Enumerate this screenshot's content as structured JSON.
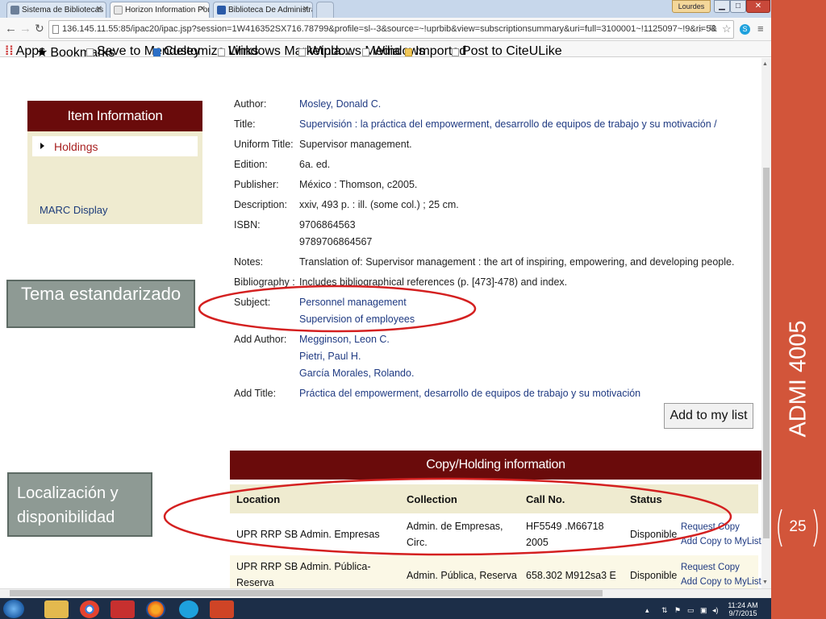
{
  "browser": {
    "tabs": [
      {
        "label": "Sistema de Bibliotecas",
        "active": false
      },
      {
        "label": "Horizon Information Porta",
        "active": true
      },
      {
        "label": "Biblioteca De Administrac",
        "active": false
      }
    ],
    "profile_label": "Lourdes",
    "url": "136.145.11.55:85/ipac20/ipac.jsp?session=1W416352SX716.78799&profile=sl--3&source=~!uprbib&view=subscriptionsummary&uri=full=3100001~!1125097~!9&ri=5&",
    "bookmarks": [
      "Apps",
      "Bookmarks",
      "Save to Mendeley",
      "Customize Links",
      "Windows Marketpla...",
      "Windows Media",
      "Windows",
      "Imported",
      "Post to CiteULike"
    ]
  },
  "sidebar_menu": {
    "header": "Item Information",
    "holdings": "Holdings",
    "marc": "MARC Display"
  },
  "record": {
    "author_label": "Author:",
    "author": "Mosley, Donald C.",
    "title_label": "Title:",
    "title": "Supervisión : la práctica del empowerment, desarrollo de equipos de trabajo y su motivación /",
    "uniform_label": "Uniform Title:",
    "uniform": "Supervisor management.",
    "edition_label": "Edition:",
    "edition": "6a. ed.",
    "publisher_label": "Publisher:",
    "publisher": "México : Thomson, c2005.",
    "description_label": "Description:",
    "description": "xxiv, 493 p. : ill. (some col.) ; 25 cm.",
    "isbn_label": "ISBN:",
    "isbn1": "9706864563",
    "isbn2": "9789706864567",
    "notes_label": "Notes:",
    "notes": "Translation of: Supervisor management : the art of inspiring, empowering, and developing people.",
    "bibliography_label": "Bibliography :",
    "bibliography": "Includes bibliographical references (p. [473]-478) and index.",
    "subject_label": "Subject:",
    "subject1": "Personnel management",
    "subject2": "Supervision of employees",
    "add_author_label": "Add Author:",
    "add_author1": "Megginson, Leon C.",
    "add_author2": "Pietri, Paul H.",
    "add_author3": "García Morales, Rolando.",
    "add_title_label": "Add Title:",
    "add_title": "Práctica del empowerment, desarrollo de equipos de trabajo y su motivación"
  },
  "add_to_list": "Add to my list",
  "copy_holding": {
    "header": "Copy/Holding information",
    "columns": [
      "Location",
      "Collection",
      "Call No.",
      "Status"
    ],
    "rows": [
      {
        "location": "UPR RRP SB Admin. Empresas",
        "collection": "Admin. de Empresas, Circ.",
        "call_no": "HF5549 .M66718 2005",
        "status": "Disponible",
        "action1": "Request Copy",
        "action2": "Add Copy to MyList"
      },
      {
        "location": "UPR RRP SB Admin. Pública-Reserva",
        "collection": "Admin. Pública, Reserva",
        "call_no": "658.302 M912sa3 E",
        "status": "Disponible",
        "action1": "Request Copy",
        "action2": "Add Copy to MyList"
      }
    ]
  },
  "slide": {
    "tema": "Tema estandarizado",
    "localizacion": "Localización y disponibilidad",
    "course": "ADMI 4005",
    "page": "25"
  },
  "taskbar": {
    "time": "11:24 AM",
    "date": "9/7/2015"
  },
  "colors": {
    "maroon": "#6a0b0b",
    "accent": "#d2553a",
    "annotation": "#d42020",
    "link": "#1f3a82"
  }
}
